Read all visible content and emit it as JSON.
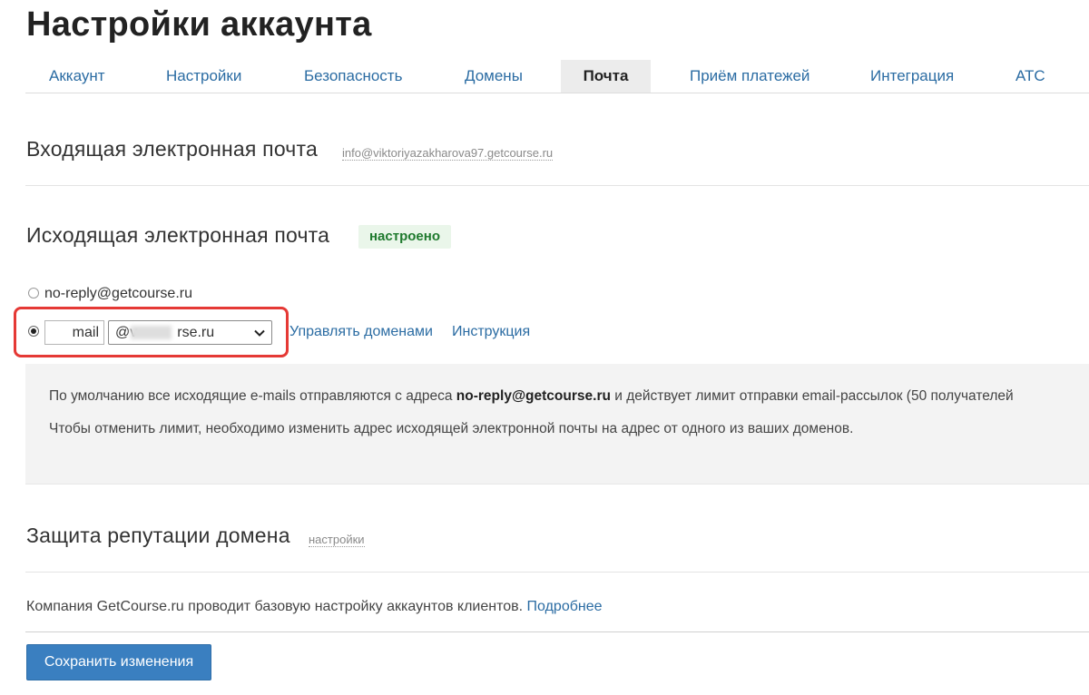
{
  "page_title": "Настройки аккаунта",
  "tabs": [
    {
      "label": "Аккаунт",
      "active": false
    },
    {
      "label": "Настройки",
      "active": false
    },
    {
      "label": "Безопасность",
      "active": false
    },
    {
      "label": "Домены",
      "active": false
    },
    {
      "label": "Почта",
      "active": true
    },
    {
      "label": "Приём платежей",
      "active": false
    },
    {
      "label": "Интеграция",
      "active": false
    },
    {
      "label": "АТС",
      "active": false
    }
  ],
  "incoming": {
    "title": "Входящая электронная почта",
    "address": "info@viktoriyazakharova97.getcourse.ru"
  },
  "outgoing": {
    "title": "Исходящая электронная почта",
    "status_badge": "настроено",
    "option_default": "no-reply@getcourse.ru",
    "option_custom": {
      "mail_value": "mail",
      "domain_prefix": "@v",
      "domain_suffix": "rse.ru"
    },
    "manage_domains_link": "Управлять доменами",
    "instruction_link": "Инструкция",
    "info": {
      "line1_prefix": "По умолчанию все исходящие e-mails отправляются с адреса ",
      "line1_bold": "no-reply@getcourse.ru",
      "line1_suffix": " и действует лимит отправки email-рассылок (50 получателей",
      "line2": "Чтобы отменить лимит, необходимо изменить адрес исходящей электронной почты на адрес от одного из ваших доменов."
    }
  },
  "reputation": {
    "title": "Защита репутации домена",
    "settings_link": "настройки"
  },
  "footer": {
    "text": "Компания GetCourse.ru проводит базовую настройку аккаунтов клиентов. ",
    "more_link": "Подробнее"
  },
  "save_button": "Сохранить изменения",
  "colors": {
    "link": "#2b6ca3",
    "badge_text": "#1f7a2e",
    "badge_bg": "#eaf6ea",
    "highlight": "#e53935",
    "button": "#3a7fc0"
  }
}
